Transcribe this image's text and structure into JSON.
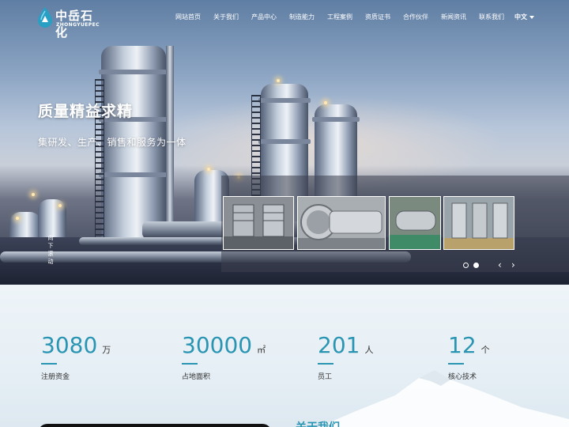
{
  "brand": {
    "name_cn": "中岳石化",
    "name_en": "ZHONGYUEPEC"
  },
  "nav": {
    "items": [
      "网站首页",
      "关于我们",
      "产品中心",
      "制造能力",
      "工程案例",
      "资质证书",
      "合作伙伴",
      "新闻资讯",
      "联系我们"
    ],
    "language": "中文"
  },
  "hero": {
    "title": "质量精益求精",
    "subtitle": "集研发、生产、销售和服务为一体",
    "scroll_hint": [
      "向",
      "下",
      "滚",
      "动"
    ],
    "thumbnails": [
      "thumb-1",
      "thumb-2",
      "thumb-3",
      "thumb-4"
    ],
    "active_slide": 2,
    "slide_count": 2
  },
  "stats": [
    {
      "value": "3080",
      "unit": "万",
      "label": "注册资金"
    },
    {
      "value": "30000",
      "unit": "㎡",
      "label": "占地面积"
    },
    {
      "value": "201",
      "unit": "人",
      "label": "员工"
    },
    {
      "value": "12",
      "unit": "个",
      "label": "核心技术"
    }
  ],
  "about": {
    "title": "关于我们"
  },
  "colors": {
    "accent": "#2a95b3",
    "text": "#333333"
  }
}
